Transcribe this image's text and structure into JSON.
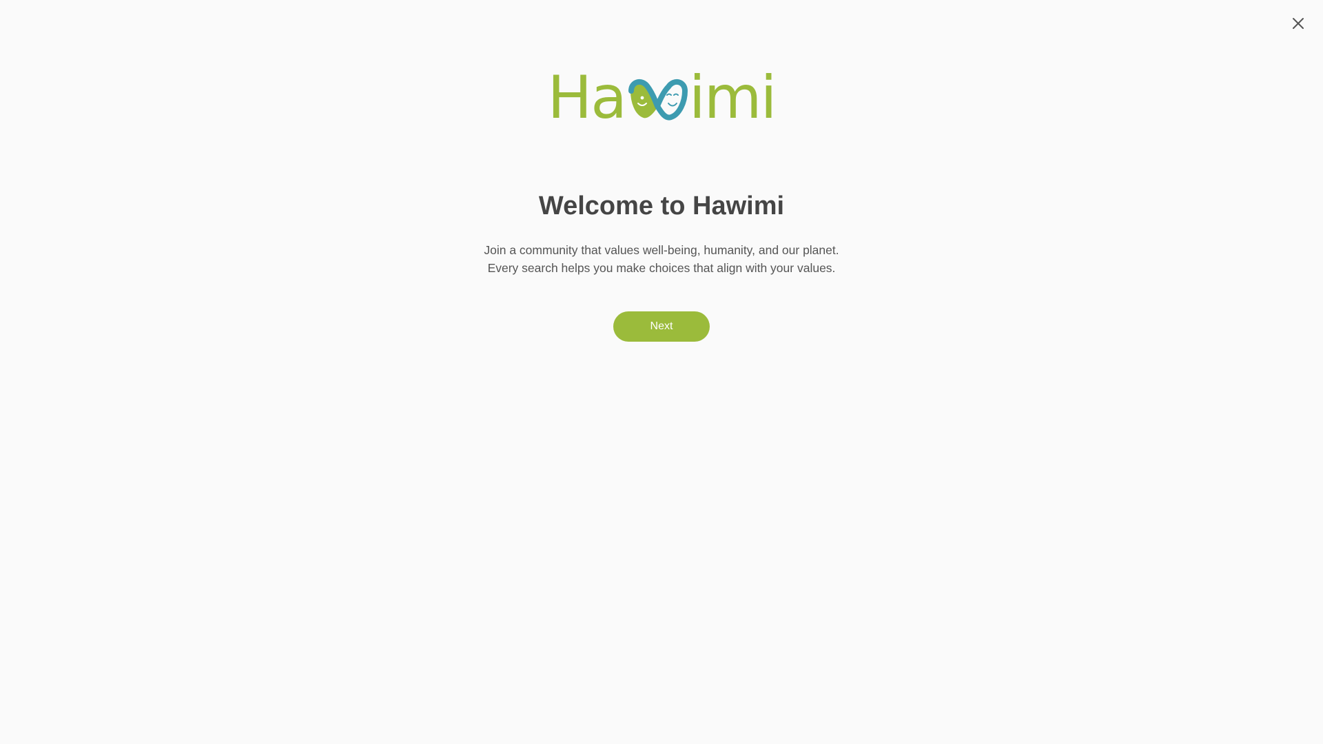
{
  "colors": {
    "background": "#fafafa",
    "brand_green": "#9bbb3b",
    "brand_teal": "#3d9bb0",
    "title_text": "#454545",
    "body_text": "#555555",
    "button_bg": "#9bbb3b",
    "button_text": "#ffffff",
    "close_icon": "#555555"
  },
  "header": {
    "close_icon": "close-icon"
  },
  "logo": {
    "prefix": "Ha",
    "suffix": "imi",
    "hearts_icon": "two-hearts-icon",
    "alt": "Hawimi"
  },
  "welcome": {
    "title": "Welcome to Hawimi",
    "line1": "Join a community that values well-being, humanity, and our planet.",
    "line2": "Every search helps you make choices that align with your values."
  },
  "actions": {
    "next_label": "Next"
  }
}
